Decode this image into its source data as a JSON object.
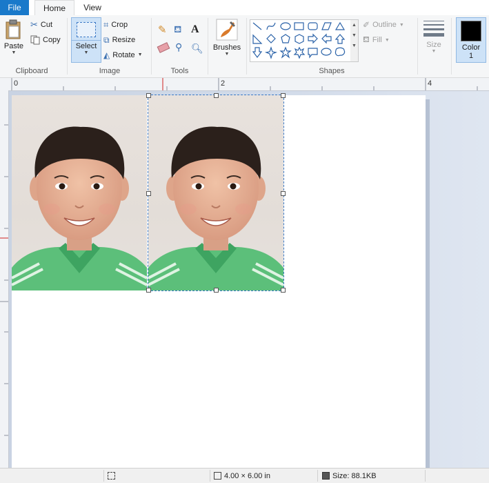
{
  "tabs": {
    "file": "File",
    "home": "Home",
    "view": "View"
  },
  "clipboard": {
    "paste": "Paste",
    "cut": "Cut",
    "copy": "Copy",
    "label": "Clipboard"
  },
  "image": {
    "select": "Select",
    "crop": "Crop",
    "resize": "Resize",
    "rotate": "Rotate",
    "label": "Image"
  },
  "tools": {
    "label": "Tools"
  },
  "brushes": {
    "label": "Brushes"
  },
  "shapes": {
    "label": "Shapes",
    "outline": "Outline",
    "fill": "Fill"
  },
  "size": {
    "label": "Size"
  },
  "color": {
    "label_line1": "Color",
    "label_line2": "1",
    "value": "#000000"
  },
  "ruler": {
    "marks": [
      "0",
      "2",
      "4"
    ]
  },
  "status": {
    "dimensions": "4.00 × 6.00 in",
    "size": "Size: 88.1KB"
  },
  "colors": {
    "file_tab": "#1979ca",
    "selection": "#3b79c6",
    "shirt": "#5cbf7a"
  }
}
